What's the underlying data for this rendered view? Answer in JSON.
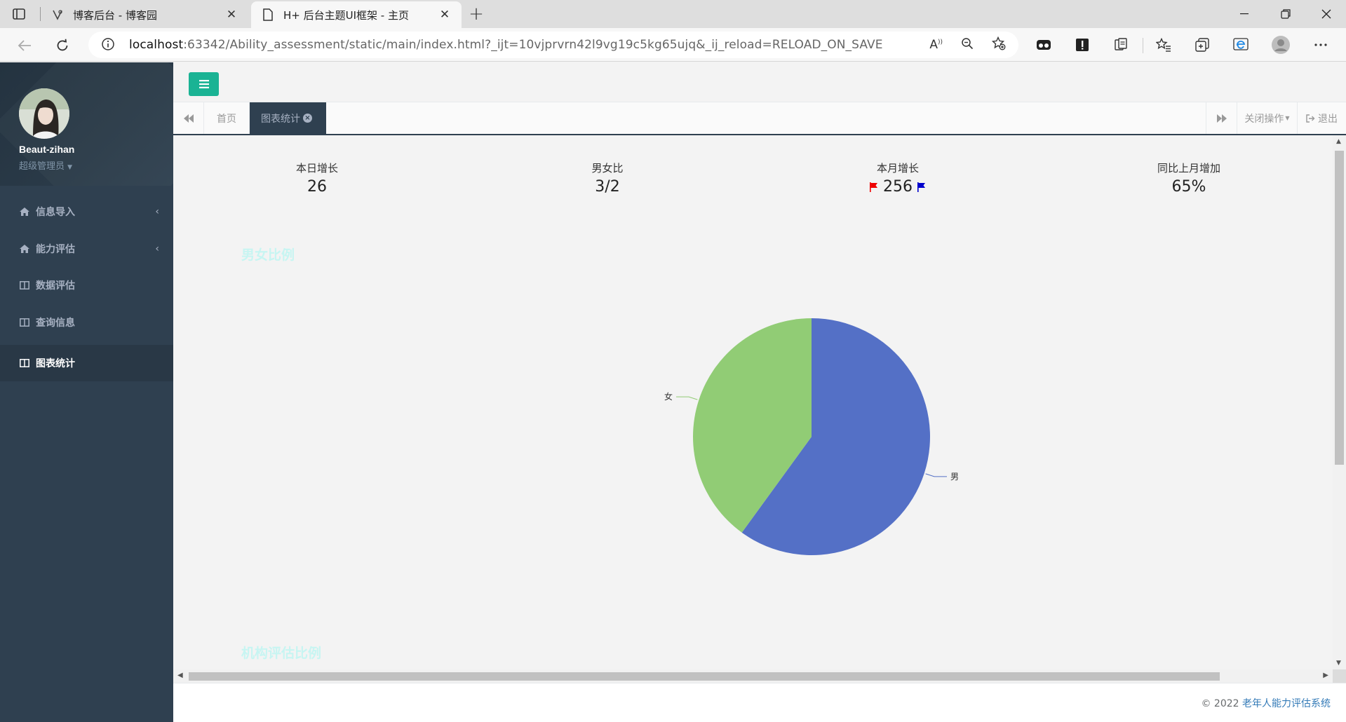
{
  "browser": {
    "tabs": [
      {
        "title": "博客后台 - 博客园",
        "active": false
      },
      {
        "title": "H+ 后台主题UI框架 - 主页",
        "active": true
      }
    ],
    "url_host": "localhost",
    "url_rest": ":63342/Ability_assessment/static/main/index.html?_ijt=10vjprvrn42l9vg19c5kg65ujq&_ij_reload=RELOAD_ON_SAVE"
  },
  "sidebar": {
    "username": "Beaut-zihan",
    "role": "超级管理员",
    "items": [
      {
        "label": "信息导入",
        "icon": "home-icon",
        "has_arrow": true,
        "active": false
      },
      {
        "label": "能力评估",
        "icon": "home-icon",
        "has_arrow": true,
        "active": false
      },
      {
        "label": "数据评估",
        "icon": "columns-icon",
        "has_arrow": false,
        "active": false
      },
      {
        "label": "查询信息",
        "icon": "columns-icon",
        "has_arrow": false,
        "active": false
      },
      {
        "label": "图表统计",
        "icon": "columns-icon",
        "has_arrow": false,
        "active": true
      }
    ]
  },
  "content_tabs": {
    "home": "首页",
    "active": "图表统计",
    "close_ops": "关闭操作",
    "logout": "退出"
  },
  "stats": [
    {
      "label": "本日增长",
      "value": "26"
    },
    {
      "label": "男女比",
      "value": "3/2"
    },
    {
      "label": "本月增长",
      "value": "256"
    },
    {
      "label": "同比上月增加",
      "value": "65%"
    }
  ],
  "sections": {
    "gender_title": "男女比例",
    "org_title": "机构评估比例"
  },
  "chart_data": {
    "type": "pie",
    "title": "",
    "labels": [
      "男",
      "女"
    ],
    "values": [
      60,
      40
    ],
    "colors": [
      "#5470c6",
      "#91cc75"
    ]
  },
  "footer": {
    "copyright": "© 2022 ",
    "system_name": "老年人能力评估系统"
  },
  "colors": {
    "sidebar_bg": "#2f4050",
    "accent_green": "#1ab394",
    "pie_male": "#5470c6",
    "pie_female": "#91cc75"
  }
}
